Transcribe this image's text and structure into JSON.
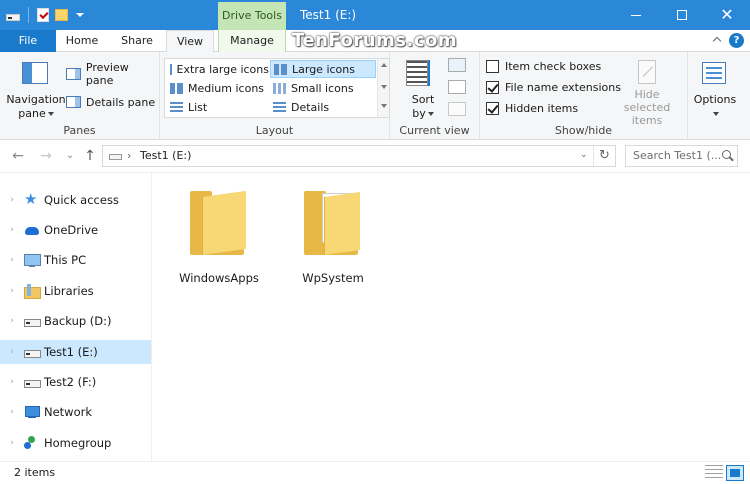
{
  "window": {
    "title": "Test1 (E:)",
    "context_tab": "Drive Tools",
    "watermark": "TenForums.com",
    "accent": "#2b88d8",
    "file_tab_color": "#1979ca",
    "context_color": "#c4e5b6",
    "minimize_glyph": "",
    "close_glyph": "✕"
  },
  "ribbon_tabs": {
    "file": "File",
    "home": "Home",
    "share": "Share",
    "view": "View",
    "manage": "Manage",
    "help": "?"
  },
  "ribbon": {
    "panes": {
      "label": "Panes",
      "navigation_pane_line1": "Navigation",
      "navigation_pane_line2": "pane",
      "preview_pane": "Preview pane",
      "details_pane": "Details pane"
    },
    "layout": {
      "label": "Layout",
      "items": [
        "Extra large icons",
        "Large icons",
        "Medium icons",
        "Small icons",
        "List",
        "Details"
      ],
      "selected": "Large icons"
    },
    "current_view": {
      "label": "Current view",
      "sort_line1": "Sort",
      "sort_line2": "by"
    },
    "show_hide": {
      "label": "Show/hide",
      "item_check_boxes": "Item check boxes",
      "item_check_boxes_checked": false,
      "file_name_extensions": "File name extensions",
      "file_name_extensions_checked": true,
      "hidden_items": "Hidden items",
      "hidden_items_checked": true,
      "hide_selected_line1": "Hide selected",
      "hide_selected_line2": "items"
    },
    "options": {
      "label": "Options"
    }
  },
  "address": {
    "back_glyph": "←",
    "forward_glyph": "→",
    "recent_glyph": "⌄",
    "up_glyph": "↑",
    "chevron": "›",
    "path": "Test1 (E:)",
    "dropdown_glyph": "⌄",
    "refresh_glyph": "↻",
    "search_placeholder": "Search Test1 (..."
  },
  "nav": {
    "expand_glyph": "›",
    "items": [
      {
        "label": "Quick access",
        "icon": "quick-access-icon"
      },
      {
        "label": "OneDrive",
        "icon": "onedrive-icon"
      },
      {
        "label": "This PC",
        "icon": "this-pc-icon"
      },
      {
        "label": "Libraries",
        "icon": "libraries-icon"
      },
      {
        "label": "Backup (D:)",
        "icon": "drive-icon"
      },
      {
        "label": "Test1 (E:)",
        "icon": "drive-icon"
      },
      {
        "label": "Test2 (F:)",
        "icon": "drive-icon"
      },
      {
        "label": "Network",
        "icon": "network-icon"
      },
      {
        "label": "Homegroup",
        "icon": "homegroup-icon"
      }
    ],
    "selected": "Test1 (E:)"
  },
  "content": {
    "items": [
      {
        "name": "WindowsApps",
        "icon": "folder-icon"
      },
      {
        "name": "WpSystem",
        "icon": "folder-with-files-icon"
      }
    ]
  },
  "status": {
    "item_count": "2 items"
  }
}
